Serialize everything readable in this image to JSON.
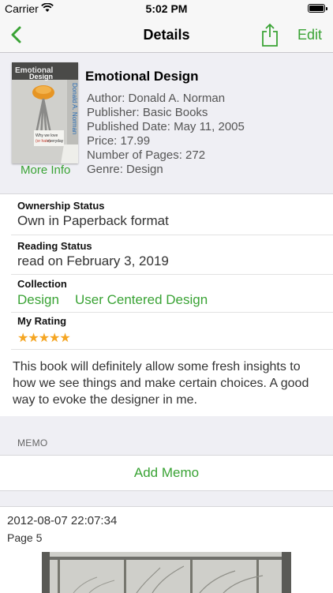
{
  "status_bar": {
    "carrier": "Carrier",
    "time": "5:02 PM"
  },
  "nav": {
    "title": "Details",
    "edit_label": "Edit"
  },
  "book": {
    "title": "Emotional Design",
    "cover_title": "Emotional Design",
    "cover_author": "Donald A. Norman",
    "cover_subtitle": "Why we love (or hate) everyday things",
    "author": "Author: Donald A. Norman",
    "publisher": "Publisher: Basic Books",
    "published_date": "Published Date: May 11, 2005",
    "price": "Price: 17.99",
    "pages": "Number of Pages: 272",
    "genre": "Genre: Design",
    "more_info": "More Info"
  },
  "ownership": {
    "label": "Ownership Status",
    "value": "Own in Paperback format"
  },
  "reading": {
    "label": "Reading Status",
    "value": "read on February 3, 2019"
  },
  "collection": {
    "label": "Collection",
    "tags": [
      "Design",
      "User Centered Design"
    ]
  },
  "rating": {
    "label": "My Rating",
    "stars": "★★★★★",
    "value": 5,
    "max": 5
  },
  "review": "This book will definitely allow some fresh insights to how we see things and make certain choices. A good way to evoke the designer in me.",
  "memo": {
    "header": "MEMO",
    "add_label": "Add Memo"
  },
  "memo_entry": {
    "date": "2012-08-07 22:07:34",
    "page": "Page 5"
  },
  "colors": {
    "accent": "#3aa335",
    "star": "#f5a623",
    "background": "#efeff4"
  }
}
